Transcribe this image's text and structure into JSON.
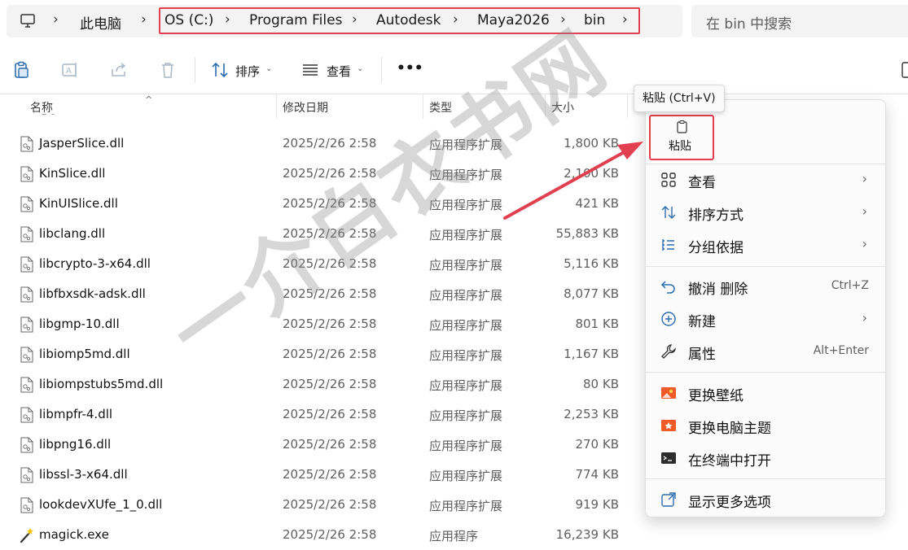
{
  "address": {
    "root": "此电脑",
    "crumbs": [
      "OS (C:)",
      "Program Files",
      "Autodesk",
      "Maya2026",
      "bin"
    ]
  },
  "search": {
    "placeholder": "在 bin 中搜索"
  },
  "toolbar": {
    "sort_label": "排序",
    "view_label": "查看",
    "more_label": "•••"
  },
  "columns": {
    "name": "名称",
    "date": "修改日期",
    "type": "类型",
    "size": "大小"
  },
  "files": [
    {
      "name": "JasperSlice.dll",
      "date": "2025/2/26 2:58",
      "type": "应用程序扩展",
      "size": "1,800 KB"
    },
    {
      "name": "KinSlice.dll",
      "date": "2025/2/26 2:58",
      "type": "应用程序扩展",
      "size": "2,100 KB"
    },
    {
      "name": "KinUISlice.dll",
      "date": "2025/2/26 2:58",
      "type": "应用程序扩展",
      "size": "421 KB"
    },
    {
      "name": "libclang.dll",
      "date": "2025/2/26 2:58",
      "type": "应用程序扩展",
      "size": "55,883 KB"
    },
    {
      "name": "libcrypto-3-x64.dll",
      "date": "2025/2/26 2:58",
      "type": "应用程序扩展",
      "size": "5,116 KB"
    },
    {
      "name": "libfbxsdk-adsk.dll",
      "date": "2025/2/26 2:58",
      "type": "应用程序扩展",
      "size": "8,077 KB"
    },
    {
      "name": "libgmp-10.dll",
      "date": "2025/2/26 2:58",
      "type": "应用程序扩展",
      "size": "801 KB"
    },
    {
      "name": "libiomp5md.dll",
      "date": "2025/2/26 2:58",
      "type": "应用程序扩展",
      "size": "1,167 KB"
    },
    {
      "name": "libiompstubs5md.dll",
      "date": "2025/2/26 2:58",
      "type": "应用程序扩展",
      "size": "80 KB"
    },
    {
      "name": "libmpfr-4.dll",
      "date": "2025/2/26 2:58",
      "type": "应用程序扩展",
      "size": "2,253 KB"
    },
    {
      "name": "libpng16.dll",
      "date": "2025/2/26 2:58",
      "type": "应用程序扩展",
      "size": "270 KB"
    },
    {
      "name": "libssl-3-x64.dll",
      "date": "2025/2/26 2:58",
      "type": "应用程序扩展",
      "size": "774 KB"
    },
    {
      "name": "lookdevXUfe_1_0.dll",
      "date": "2025/2/26 2:58",
      "type": "应用程序扩展",
      "size": "919 KB"
    },
    {
      "name": "magick.exe",
      "date": "2025/2/26 2:58",
      "type": "应用程序",
      "size": "16,239 KB",
      "icon": "magic-wand-icon"
    }
  ],
  "tooltip": "粘贴 (Ctrl+V)",
  "context_menu": {
    "paste_label": "粘贴",
    "items": [
      {
        "label": "查看",
        "submenu": true,
        "icon": "grid-icon"
      },
      {
        "label": "排序方式",
        "submenu": true,
        "icon": "sort-icon"
      },
      {
        "label": "分组依据",
        "submenu": true,
        "icon": "group-icon"
      },
      {
        "label": "撤消 删除",
        "shortcut": "Ctrl+Z",
        "icon": "undo-icon"
      },
      {
        "label": "新建",
        "submenu": true,
        "icon": "new-icon"
      },
      {
        "label": "属性",
        "shortcut": "Alt+Enter",
        "icon": "wrench-icon"
      },
      {
        "label": "更换壁纸",
        "icon": "wallpaper-icon"
      },
      {
        "label": "更换电脑主题",
        "icon": "theme-icon"
      },
      {
        "label": "在终端中打开",
        "icon": "terminal-icon"
      },
      {
        "label": "显示更多选项",
        "icon": "more-options-icon"
      }
    ]
  },
  "watermark": "一介白衣书网",
  "colors": {
    "highlight": "#e0404f",
    "accent": "#0067c0",
    "orange": "#f05a28"
  }
}
